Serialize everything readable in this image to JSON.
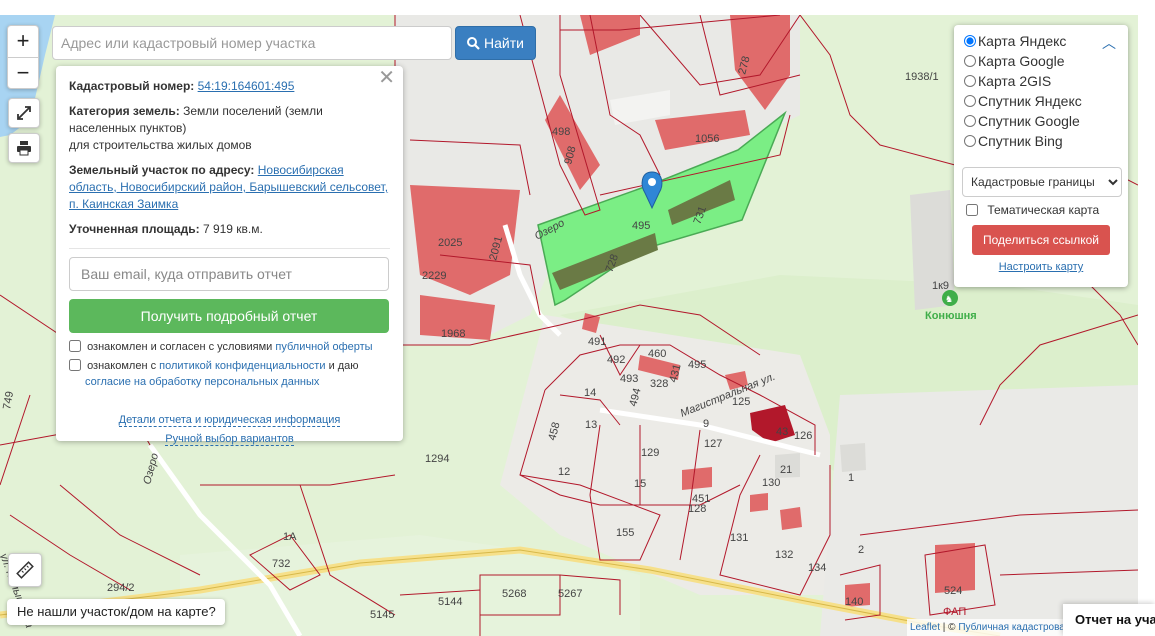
{
  "map": {
    "plot_labels": [
      "2025",
      "2229",
      "2091",
      "1968",
      "498",
      "908",
      "1056",
      "278",
      "495",
      "731",
      "728",
      "491",
      "492",
      "493",
      "460",
      "328",
      "431",
      "494",
      "14",
      "13",
      "458",
      "129",
      "127",
      "15",
      "12",
      "1294",
      "451",
      "128",
      "130",
      "21",
      "1",
      "155",
      "131",
      "132",
      "134",
      "732",
      "1А",
      "294/2",
      "5144",
      "5268",
      "5267",
      "5145",
      "140",
      "524",
      "1к9",
      "1938/1",
      "749",
      "125",
      "43",
      "126",
      "9",
      "2",
      "ФАП"
    ],
    "street_labels": [
      "Озеро",
      "Магистральная ул.",
      "Озеро",
      "ул. Камышевка"
    ],
    "poi_label": "Конюшня",
    "marker_name": "selected-plot-marker"
  },
  "controls": {
    "zoom_in": "+",
    "zoom_out": "−"
  },
  "search": {
    "placeholder": "Адрес или кадастровый номер участка",
    "button_label": "Найти"
  },
  "parcel": {
    "cad_label": "Кадастровый номер:",
    "cad_number": "54:19:164601:495",
    "category_label": "Категория земель:",
    "category_value": "Земли поселений (земли населенных пунктов)",
    "category_use": "для строительства жилых домов",
    "address_label": "Земельный участок по адресу:",
    "address_value": "Новосибирская область, Новосибирский район, Барышевский сельсовет, п. Каинская Заимка",
    "area_label": "Уточненная площадь:",
    "area_value": "7 919 кв.м.",
    "email_placeholder": "Ваш email, куда отправить отчет",
    "report_button": "Получить подробный отчет",
    "agree_text_1": "ознакомлен и согласен с условиями",
    "agree_link_1": "публичной оферты",
    "agree_text_2a": "ознакомлен с",
    "agree_link_2": "политикой конфиденциальности",
    "agree_text_2b": "и даю",
    "agree_link_3": "согласие на обработку персональных данных",
    "details_link": "Детали отчета и юридическая информация",
    "manual_link": "Ручной выбор вариантов"
  },
  "layers": {
    "options": [
      {
        "label": "Карта Яндекс",
        "selected": true
      },
      {
        "label": "Карта Google",
        "selected": false
      },
      {
        "label": "Карта 2GIS",
        "selected": false
      },
      {
        "label": "Спутник Яндекс",
        "selected": false
      },
      {
        "label": "Спутник Google",
        "selected": false
      },
      {
        "label": "Спутник Bing",
        "selected": false
      }
    ],
    "overlay_select": "Кадастровые границы",
    "thematic_label": "Тематическая карта",
    "share_button": "Поделиться ссылкой",
    "configure_link": "Настроить карту"
  },
  "footer": {
    "not_found": "Не нашли участок/дом на карте?",
    "leaflet": "Leaflet",
    "attribution": "Публичная кадастровая карта",
    "report_tab": "Отчет на участок"
  },
  "colors": {
    "parcel_border": "#b2182b",
    "selected_parcel": "#7bee85",
    "building": "#e06b6b",
    "report_button": "#5cb85c",
    "share_button": "#d9534f",
    "find_button": "#3a7fc1"
  }
}
